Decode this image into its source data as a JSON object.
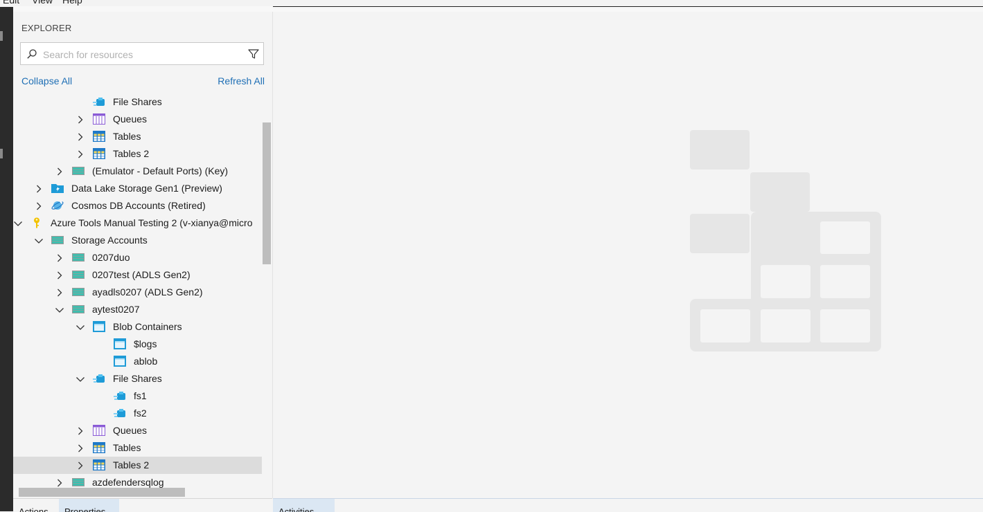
{
  "menu": {
    "items": [
      "Edit",
      "View",
      "Help"
    ]
  },
  "explorer": {
    "title": "EXPLORER",
    "search": {
      "placeholder": "Search for resources",
      "value": ""
    },
    "collapse_all": "Collapse All",
    "refresh_all": "Refresh All"
  },
  "tree": [
    {
      "label": "File Shares",
      "depth": 3,
      "chevron": "none",
      "icon": "file-share"
    },
    {
      "label": "Queues",
      "depth": 3,
      "chevron": "right",
      "icon": "queue"
    },
    {
      "label": "Tables",
      "depth": 3,
      "chevron": "right",
      "icon": "table"
    },
    {
      "label": "Tables 2",
      "depth": 3,
      "chevron": "right",
      "icon": "table"
    },
    {
      "label": "(Emulator - Default Ports) (Key)",
      "depth": 2,
      "chevron": "right",
      "icon": "storage-account"
    },
    {
      "label": "Data Lake Storage Gen1 (Preview)",
      "depth": 1,
      "chevron": "right",
      "icon": "data-lake"
    },
    {
      "label": "Cosmos DB Accounts (Retired)",
      "depth": 1,
      "chevron": "right",
      "icon": "cosmos-db"
    },
    {
      "label": "Azure Tools Manual Testing 2 (v-xianya@micro",
      "depth": 0,
      "chevron": "down",
      "icon": "key"
    },
    {
      "label": "Storage Accounts",
      "depth": 1,
      "chevron": "down",
      "icon": "storage-account"
    },
    {
      "label": "0207duo",
      "depth": 2,
      "chevron": "right",
      "icon": "storage-account"
    },
    {
      "label": "0207test (ADLS Gen2)",
      "depth": 2,
      "chevron": "right",
      "icon": "storage-account"
    },
    {
      "label": "ayadls0207 (ADLS Gen2)",
      "depth": 2,
      "chevron": "right",
      "icon": "storage-account"
    },
    {
      "label": "aytest0207",
      "depth": 2,
      "chevron": "down",
      "icon": "storage-account"
    },
    {
      "label": "Blob Containers",
      "depth": 3,
      "chevron": "down",
      "icon": "blob-container"
    },
    {
      "label": "$logs",
      "depth": 4,
      "chevron": "none",
      "icon": "blob-container"
    },
    {
      "label": "ablob",
      "depth": 4,
      "chevron": "none",
      "icon": "blob-container"
    },
    {
      "label": "File Shares",
      "depth": 3,
      "chevron": "down",
      "icon": "file-share"
    },
    {
      "label": "fs1",
      "depth": 4,
      "chevron": "none",
      "icon": "file-share"
    },
    {
      "label": "fs2",
      "depth": 4,
      "chevron": "none",
      "icon": "file-share"
    },
    {
      "label": "Queues",
      "depth": 3,
      "chevron": "right",
      "icon": "queue"
    },
    {
      "label": "Tables",
      "depth": 3,
      "chevron": "right",
      "icon": "table"
    },
    {
      "label": "Tables 2",
      "depth": 3,
      "chevron": "right",
      "icon": "table",
      "selected": true
    },
    {
      "label": "azdefendersqlog",
      "depth": 2,
      "chevron": "right",
      "icon": "storage-account"
    }
  ],
  "bottom_tabs": {
    "actions": "Actions",
    "properties": "Properties",
    "activities": "Activities"
  },
  "colors": {
    "link": "#1f6fb5",
    "selected_row": "#dcdcdc",
    "active_tab": "#dbe7f3",
    "placeholder_logo": "#e6e6e6"
  }
}
